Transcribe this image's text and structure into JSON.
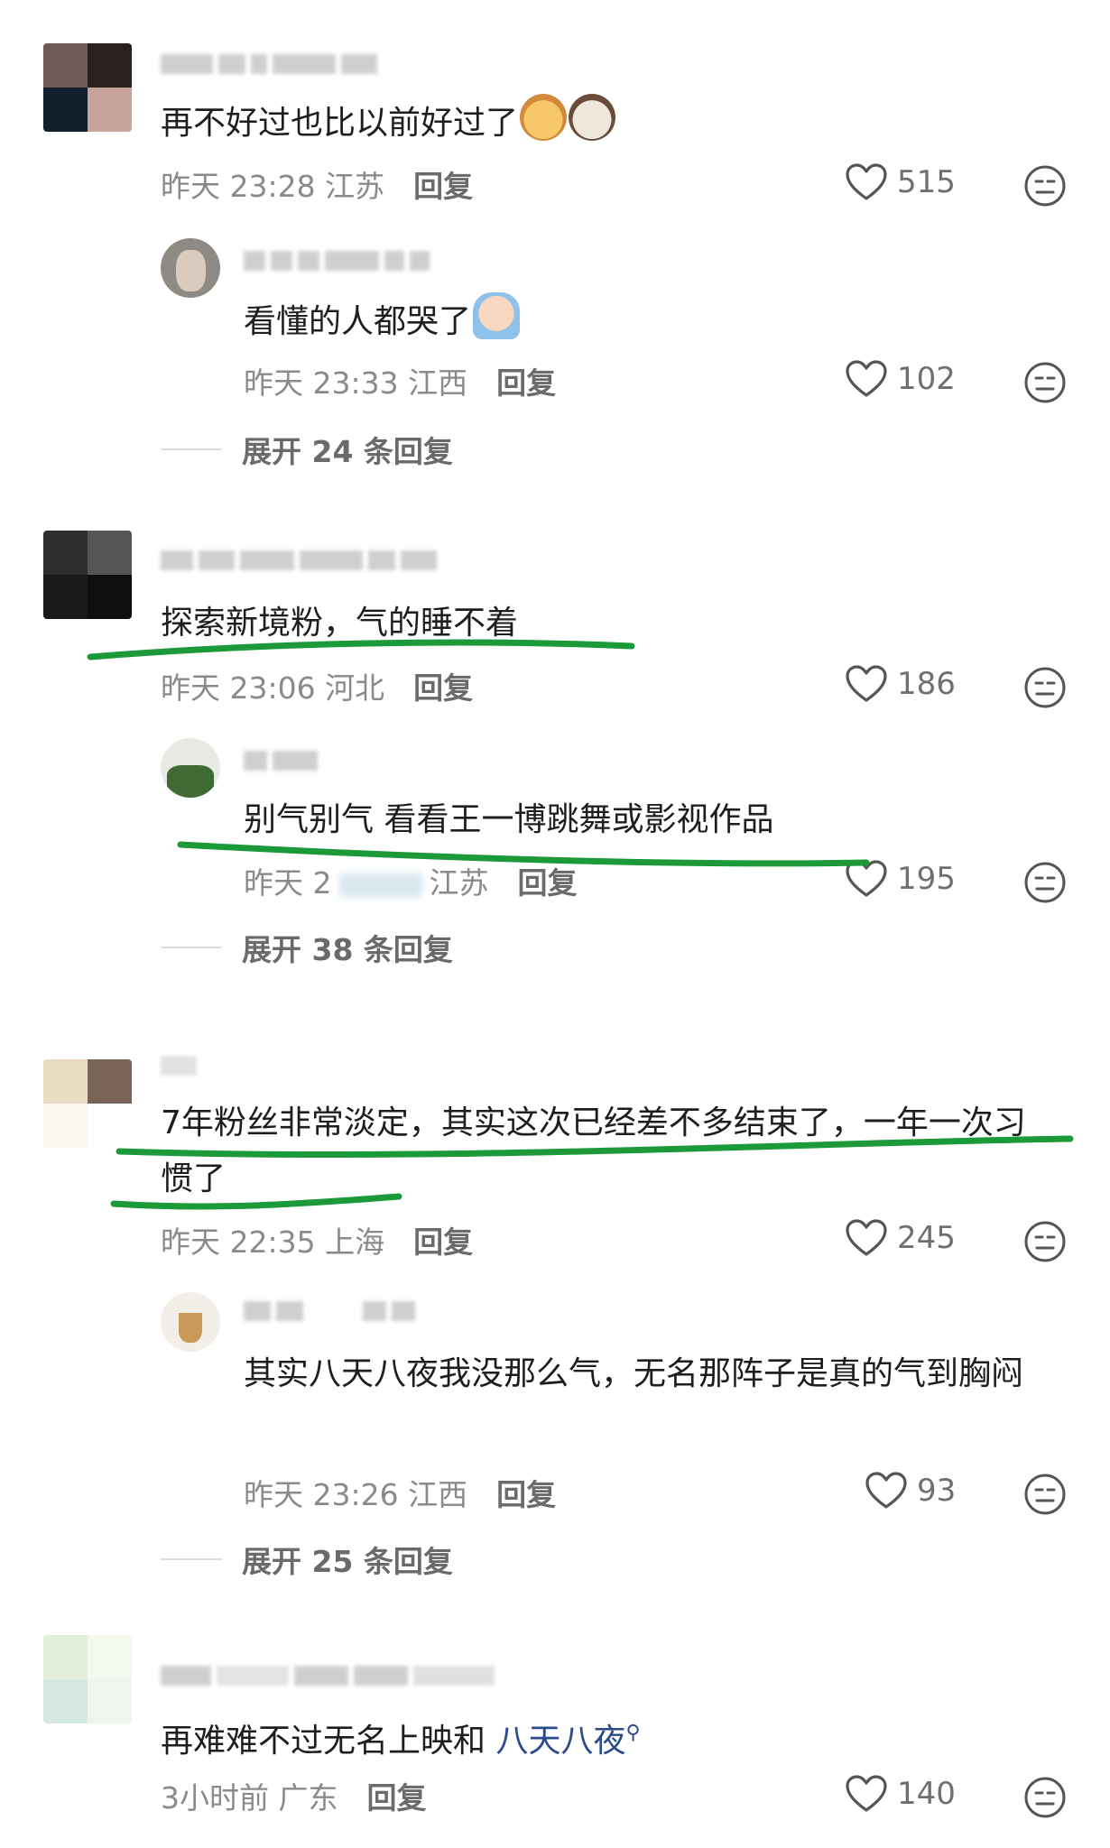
{
  "comments": [
    {
      "text": "再不好过也比以前好过了",
      "meta": "昨天 23:28 江苏",
      "reply_label": "回复",
      "likes": "515",
      "replies": [
        {
          "text": "看懂的人都哭了",
          "meta": "昨天 23:33 江西",
          "reply_label": "回复",
          "likes": "102"
        }
      ],
      "expand": "展开 24 条回复"
    },
    {
      "text": "探索新境粉，气的睡不着",
      "meta": "昨天 23:06 河北",
      "reply_label": "回复",
      "likes": "186",
      "replies": [
        {
          "text": "别气别气 看看王一博跳舞或影视作品",
          "meta": "昨天 2",
          "meta_tail": "江苏",
          "reply_label": "回复",
          "likes": "195"
        }
      ],
      "expand": "展开 38 条回复"
    },
    {
      "text": "7年粉丝非常淡定，其实这次已经差不多结束了，一年一次习惯了",
      "meta": "昨天 22:35 上海",
      "reply_label": "回复",
      "likes": "245",
      "replies": [
        {
          "text": "其实八天八夜我没那么气，无名那阵子是真的气到胸闷",
          "meta": "昨天 23:26 江西",
          "reply_label": "回复",
          "likes": "93"
        }
      ],
      "expand": "展开 25 条回复"
    },
    {
      "text_plain": "再难难不过无名上映和 ",
      "text_link": "八天八夜",
      "meta": "3小时前 广东",
      "reply_label": "回复",
      "likes": "140"
    }
  ],
  "icons": {
    "like": "heart-outline-icon",
    "dislike": "meh-face-icon",
    "search_link": "search-icon"
  },
  "colors": {
    "highlight": "#1c9a3a",
    "meta_gray": "#8a8a8a",
    "link": "#2b4a8a"
  }
}
